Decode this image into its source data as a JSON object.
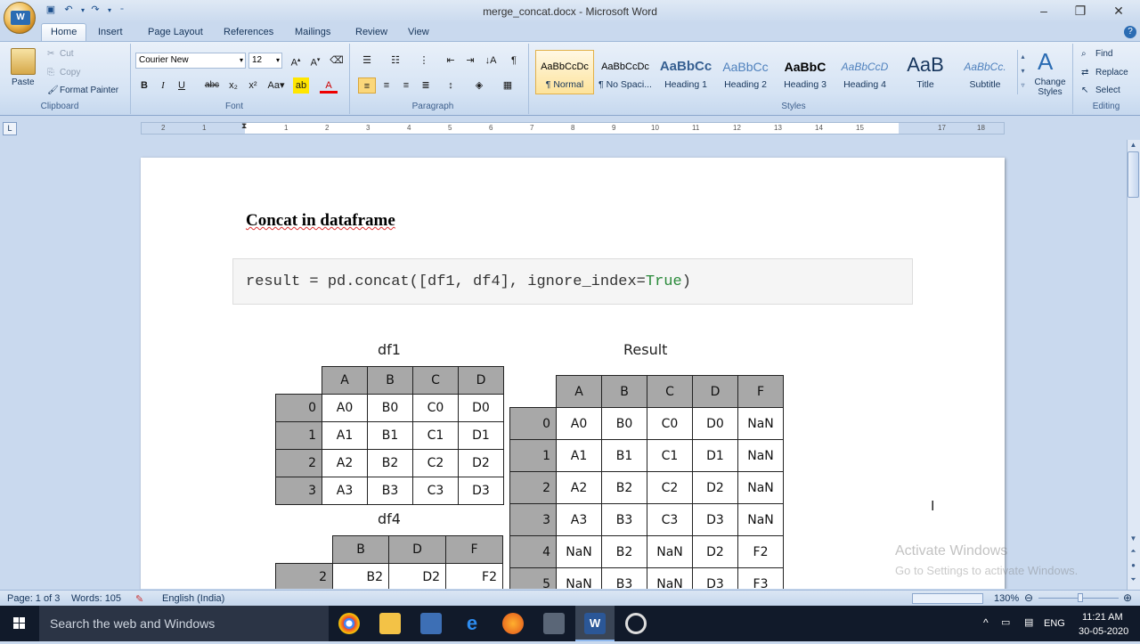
{
  "window": {
    "title": "merge_concat.docx - Microsoft Word",
    "office_button": "W"
  },
  "tabs": [
    "Home",
    "Insert",
    "Page Layout",
    "References",
    "Mailings",
    "Review",
    "View"
  ],
  "ribbon": {
    "clipboard": {
      "paste": "Paste",
      "cut": "Cut",
      "copy": "Copy",
      "format_painter": "Format Painter",
      "label": "Clipboard"
    },
    "font": {
      "family": "Courier New",
      "size": "12",
      "label": "Font"
    },
    "paragraph": {
      "label": "Paragraph"
    },
    "styles": {
      "label": "Styles",
      "items": [
        {
          "preview": "AaBbCcDc",
          "name": "¶ Normal"
        },
        {
          "preview": "AaBbCcDc",
          "name": "¶ No Spaci..."
        },
        {
          "preview": "AaBbCc",
          "name": "Heading 1"
        },
        {
          "preview": "AaBbCc",
          "name": "Heading 2"
        },
        {
          "preview": "AaBbC",
          "name": "Heading 3"
        },
        {
          "preview": "AaBbCcD",
          "name": "Heading 4"
        },
        {
          "preview": "AaB",
          "name": "Title"
        },
        {
          "preview": "AaBbCc.",
          "name": "Subtitle"
        }
      ],
      "change_styles": "Change Styles"
    },
    "editing": {
      "find": "Find",
      "replace": "Replace",
      "select": "Select",
      "label": "Editing"
    }
  },
  "ruler": {
    "numbers": [
      "2",
      "1",
      "1",
      "2",
      "3",
      "4",
      "5",
      "6",
      "7",
      "8",
      "9",
      "10",
      "11",
      "12",
      "13",
      "14",
      "15",
      "17",
      "18"
    ]
  },
  "document": {
    "heading": "Concat in dataframe",
    "code": {
      "prefix": "result = pd.concat([df1, df4], ignore_index=",
      "keyword": "True",
      "suffix": ")"
    },
    "df1": {
      "caption": "df1",
      "columns": [
        "A",
        "B",
        "C",
        "D"
      ],
      "rows": [
        {
          "index": "0",
          "cells": [
            "A0",
            "B0",
            "C0",
            "D0"
          ]
        },
        {
          "index": "1",
          "cells": [
            "A1",
            "B1",
            "C1",
            "D1"
          ]
        },
        {
          "index": "2",
          "cells": [
            "A2",
            "B2",
            "C2",
            "D2"
          ]
        },
        {
          "index": "3",
          "cells": [
            "A3",
            "B3",
            "C3",
            "D3"
          ]
        }
      ]
    },
    "df4": {
      "caption": "df4",
      "columns": [
        "B",
        "D",
        "F"
      ],
      "rows": [
        {
          "index": "2",
          "cells": [
            "B2",
            "D2",
            "F2"
          ]
        }
      ]
    },
    "result": {
      "caption": "Result",
      "columns": [
        "A",
        "B",
        "C",
        "D",
        "F"
      ],
      "rows": [
        {
          "index": "0",
          "cells": [
            "A0",
            "B0",
            "C0",
            "D0",
            "NaN"
          ]
        },
        {
          "index": "1",
          "cells": [
            "A1",
            "B1",
            "C1",
            "D1",
            "NaN"
          ]
        },
        {
          "index": "2",
          "cells": [
            "A2",
            "B2",
            "C2",
            "D2",
            "NaN"
          ]
        },
        {
          "index": "3",
          "cells": [
            "A3",
            "B3",
            "C3",
            "D3",
            "NaN"
          ]
        },
        {
          "index": "4",
          "cells": [
            "NaN",
            "B2",
            "NaN",
            "D2",
            "F2"
          ]
        },
        {
          "index": "5",
          "cells": [
            "NaN",
            "B3",
            "NaN",
            "D3",
            "F3"
          ]
        }
      ]
    }
  },
  "watermark": {
    "line1": "Activate Windows",
    "line2": "Go to Settings to activate Windows."
  },
  "statusbar": {
    "page": "Page: 1 of 3",
    "words": "Words: 105",
    "language": "English (India)",
    "zoom": "130%"
  },
  "taskbar": {
    "search_placeholder": "Search the web and Windows",
    "lang": "ENG",
    "time": "11:21 AM",
    "date": "30-05-2020"
  }
}
